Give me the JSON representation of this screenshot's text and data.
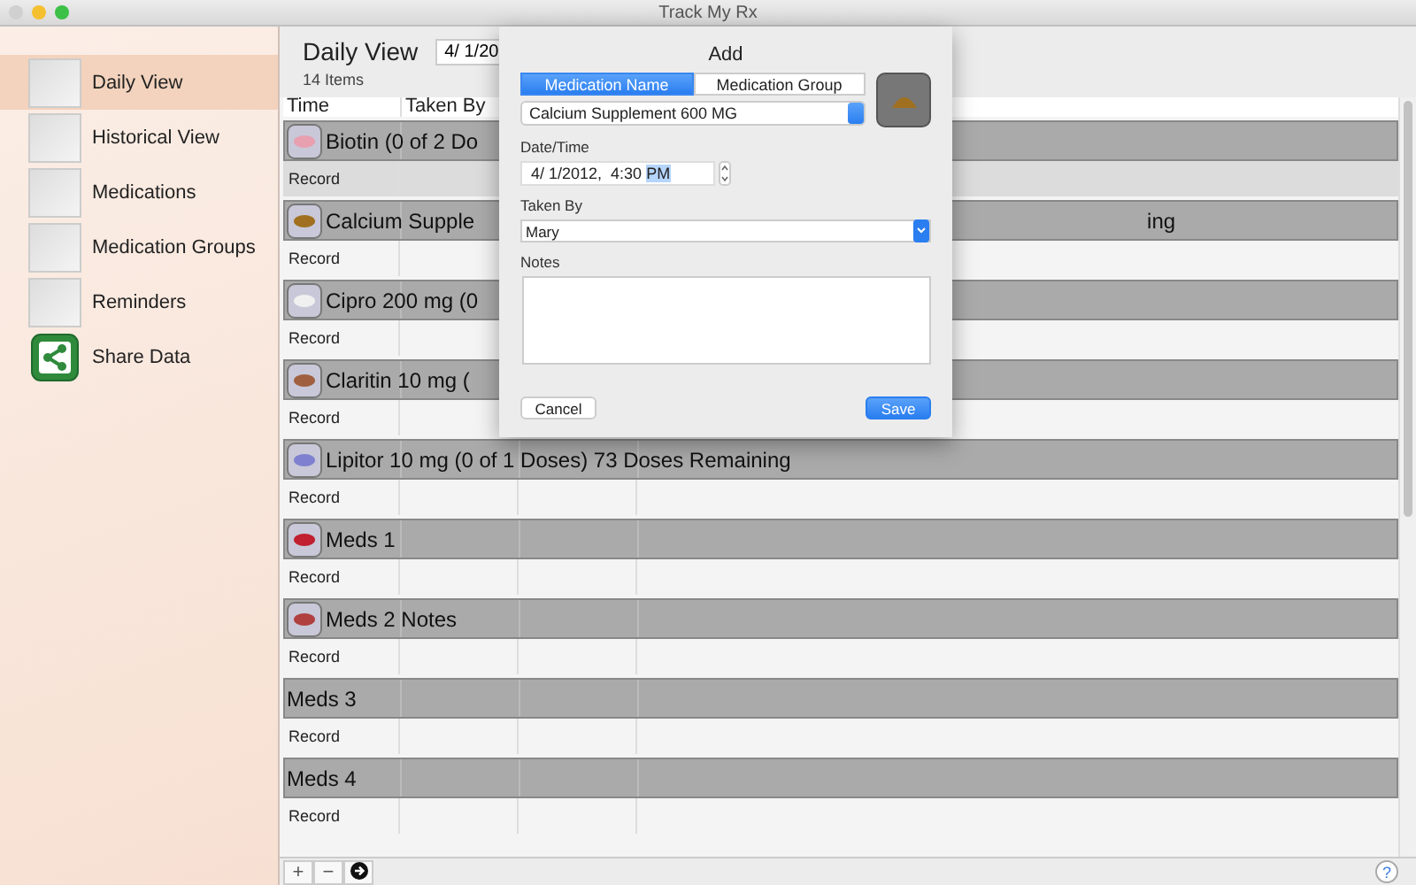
{
  "window": {
    "title": "Track My Rx"
  },
  "sidebar": {
    "items": [
      {
        "label": "Daily View",
        "selected": true,
        "kind": "photo"
      },
      {
        "label": "Historical View",
        "selected": false,
        "kind": "photo"
      },
      {
        "label": "Medications",
        "selected": false,
        "kind": "photo"
      },
      {
        "label": "Medication Groups",
        "selected": false,
        "kind": "photo"
      },
      {
        "label": "Reminders",
        "selected": false,
        "kind": "photo"
      },
      {
        "label": "Share Data",
        "selected": false,
        "kind": "share"
      }
    ]
  },
  "header": {
    "title": "Daily View",
    "date": "4/ 1/20",
    "count": "14 Items"
  },
  "table": {
    "columns": [
      "Time",
      "Taken By"
    ],
    "groups": [
      {
        "label": "Biotin (0 of 2 Do",
        "kind": "pill",
        "color": "#e8a0b0",
        "record": {
          "label": "Record",
          "selected": true
        }
      },
      {
        "label": "Calcium Supple",
        "trailing": "ing",
        "kind": "pill",
        "color": "#a07020",
        "record": {
          "label": "Record",
          "selected": false
        }
      },
      {
        "label": "Cipro 200 mg (0",
        "kind": "pill",
        "color": "#f0f0f0",
        "record": {
          "label": "Record",
          "selected": false
        }
      },
      {
        "label": "Claritin 10 mg (",
        "kind": "pill",
        "color": "#a06040",
        "record": {
          "label": "Record",
          "selected": false
        }
      },
      {
        "label": "Lipitor 10 mg (0 of 1 Doses) 73 Doses Remaining",
        "kind": "pill",
        "color": "#8080d0",
        "record": {
          "label": "Record",
          "selected": false
        }
      },
      {
        "label": "Meds 1",
        "kind": "pill",
        "color": "#c02030",
        "record": {
          "label": "Record",
          "selected": false
        }
      },
      {
        "label": "Meds 2 Notes",
        "kind": "pill",
        "color": "#b04040",
        "record": {
          "label": "Record",
          "selected": false
        }
      },
      {
        "label": "Meds 3",
        "kind": "plain",
        "record": {
          "label": "Record",
          "selected": false
        }
      },
      {
        "label": "Meds 4",
        "kind": "plain",
        "record": {
          "label": "Record",
          "selected": false
        }
      }
    ]
  },
  "bottom_bar": {
    "buttons": [
      "+",
      "−"
    ],
    "help": "?"
  },
  "dialog": {
    "title": "Add",
    "segments": [
      {
        "label": "Medication Name",
        "selected": true
      },
      {
        "label": "Medication Group",
        "selected": false
      }
    ],
    "medication": "Calcium Supplement 600 MG",
    "date_label": "Date/Time",
    "date_value": "4/ 1/2012,  4:30 ",
    "date_selected": "PM",
    "taken_by_label": "Taken By",
    "taken_by": "Mary",
    "notes_label": "Notes",
    "cancel": "Cancel",
    "save": "Save"
  }
}
